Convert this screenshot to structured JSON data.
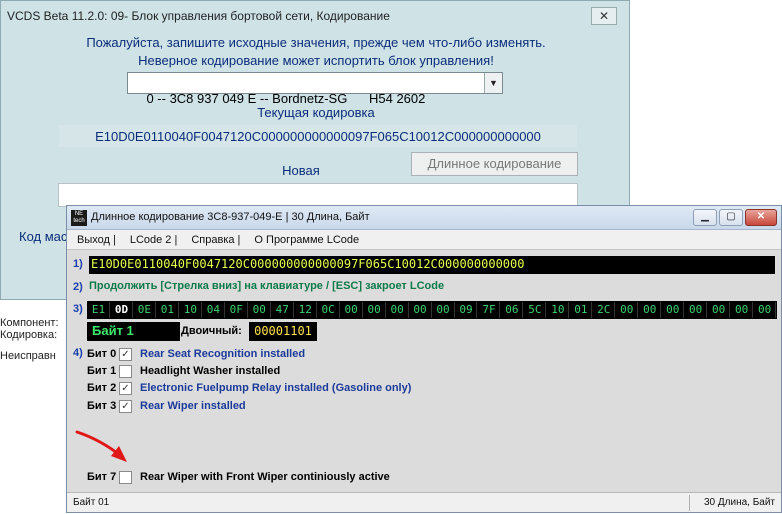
{
  "background_window": {
    "title": "VCDS Beta 11.2.0: 09- Блок управления бортовой сети,  Кодирование",
    "close_glyph": "✕",
    "warning_line1": "Пожалуйста, запишите исходные значения, прежде чем что-либо изменять.",
    "warning_line2": "Неверное кодирование может испортить блок управления!",
    "module_select_value": "0 -- 3C8 937 049 E -- Bordnetz-SG      H54 2602",
    "current_coding_label": "Текущая кодировка",
    "current_coding_value": "E10D0E0110040F0047120C000000000000097F065C10012C000000000000",
    "new_coding_label": "Новая",
    "long_coding_button": "Длинное кодирование",
    "kod_label": "Код мас",
    "side_texts": [
      "Компонент:",
      "Кодировка:",
      "Неисправн"
    ]
  },
  "lcode_window": {
    "title": "Длинное кодирование  3C8-937-049-E | 30 Длина, Байт",
    "logo_text": "NE tech",
    "window_buttons": {
      "minimize": "▁",
      "maximize": "▢",
      "close": "✕"
    },
    "menu": [
      "Выход |",
      "LCode 2 |",
      "Справка |",
      "О Программе LCode"
    ],
    "section_numbers": [
      "1)",
      "2)",
      "3)",
      "4)"
    ],
    "full_code": "E10D0E0110040F0047120C000000000000097F065C10012C000000000000",
    "instruction": "Продолжить [Стрелка вниз] на клавиатуре / [ESC] закроет LCode",
    "bytes": [
      "E1",
      "0D",
      "0E",
      "01",
      "10",
      "04",
      "0F",
      "00",
      "47",
      "12",
      "0C",
      "00",
      "00",
      "00",
      "00",
      "00",
      "09",
      "7F",
      "06",
      "5C",
      "10",
      "01",
      "2C",
      "00",
      "00",
      "00",
      "00",
      "00",
      "00",
      "00"
    ],
    "selected_byte_index": 1,
    "byte_label": "Байт 1",
    "binary_label": "Двоичный:",
    "binary_value": "00001101",
    "bits": [
      {
        "label": "Бит 0",
        "checked": true,
        "checkmark": "✓",
        "description": "Rear Seat Recognition installed",
        "color": "#1b3a9a"
      },
      {
        "label": "Бит 1",
        "checked": false,
        "checkmark": "",
        "description": "Headlight Washer installed",
        "color": "#000000"
      },
      {
        "label": "Бит 2",
        "checked": true,
        "checkmark": "✓",
        "description": "Electronic Fuelpump Relay installed (Gasoline only)",
        "color": "#1b3a9a"
      },
      {
        "label": "Бит 3",
        "checked": true,
        "checkmark": "✓",
        "description": "Rear Wiper installed",
        "color": "#1b3a9a"
      },
      {
        "label": "Бит 7",
        "checked": false,
        "checkmark": "",
        "description": "Rear Wiper with Front Wiper continiously active",
        "color": "#000000"
      }
    ],
    "status_left": "Байт 01",
    "status_right": "30 Длина, Байт",
    "colors": {
      "code_text": "#e8ff4c",
      "byte_text": "#3cd36e",
      "instruction_text": "#0d7a4a",
      "section_number": "#1a3fae",
      "arrow": "#e01818"
    }
  }
}
